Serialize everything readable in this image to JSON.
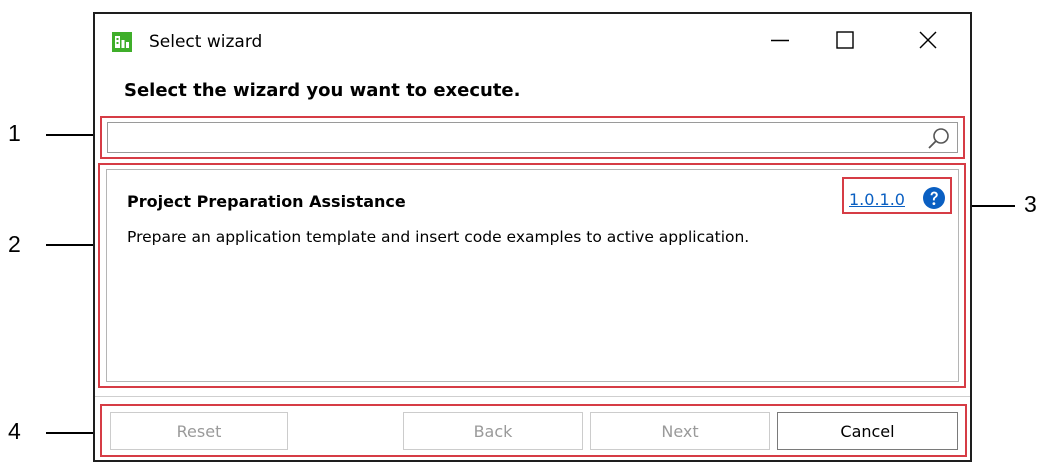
{
  "window": {
    "title": "Select wizard",
    "heading": "Select the wizard you want to execute."
  },
  "search": {
    "value": "",
    "placeholder": "",
    "icon": "search-icon"
  },
  "wizards": [
    {
      "name": "Project Preparation Assistance",
      "description": "Prepare an application template and insert code examples to active application.",
      "version": "1.0.1.0",
      "help_icon": "help-icon"
    }
  ],
  "buttons": {
    "reset": "Reset",
    "back": "Back",
    "next": "Next",
    "cancel": "Cancel"
  },
  "callouts": [
    "1",
    "2",
    "3",
    "4"
  ],
  "colors": {
    "highlight": "#d63c45",
    "link": "#0a5fc2",
    "help_icon": "#0a5fc2",
    "app_icon": "#3fae2a"
  }
}
